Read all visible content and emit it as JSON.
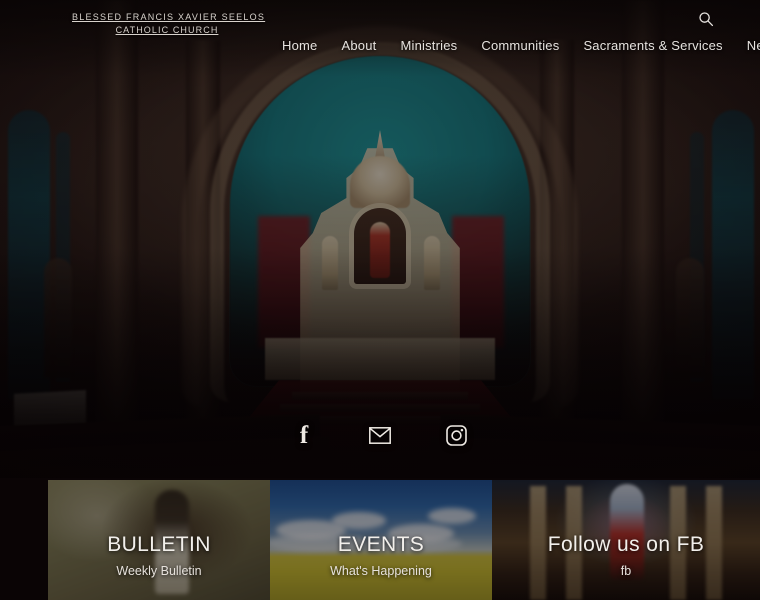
{
  "site": {
    "brand_line1": "BLESSED  FRANCIS  XAVIER  SEELOS",
    "brand_line2": "CATHOLIC CHURCH"
  },
  "header": {
    "search_icon": "search-icon",
    "nav": [
      {
        "label": "Home"
      },
      {
        "label": "About"
      },
      {
        "label": "Ministries"
      },
      {
        "label": "Communities"
      },
      {
        "label": "Sacraments & Services"
      },
      {
        "label": "News"
      }
    ]
  },
  "social": [
    {
      "name": "facebook-icon",
      "glyph": "f"
    },
    {
      "name": "email-icon",
      "glyph": ""
    },
    {
      "name": "instagram-icon",
      "glyph": ""
    }
  ],
  "cards": [
    {
      "title": "BULLETIN",
      "subtitle": "Weekly Bulletin"
    },
    {
      "title": "EVENTS",
      "subtitle": "What's Happening"
    },
    {
      "title": "Follow us on FB",
      "subtitle": "fb"
    }
  ],
  "colors": {
    "dome_teal": "#17888f",
    "nav_text": "#e6e2de",
    "brand_text": "#d8d2cc",
    "page_background": "#0a0405",
    "card_title": "#f2efeb"
  }
}
